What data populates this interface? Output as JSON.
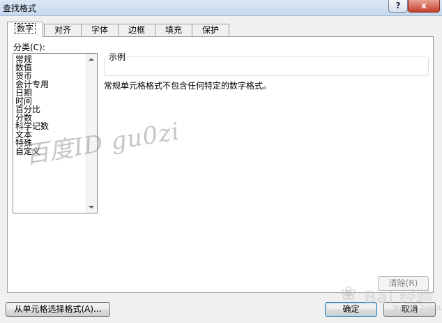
{
  "window": {
    "title": "查找格式",
    "help_label": "?",
    "close_label": "x"
  },
  "tabs": [
    {
      "label": "数字",
      "active": true
    },
    {
      "label": "对齐",
      "active": false
    },
    {
      "label": "字体",
      "active": false
    },
    {
      "label": "边框",
      "active": false
    },
    {
      "label": "填充",
      "active": false
    },
    {
      "label": "保护",
      "active": false
    }
  ],
  "category": {
    "label": "分类(C):",
    "items": [
      "常规",
      "数值",
      "货币",
      "会计专用",
      "日期",
      "时间",
      "百分比",
      "分数",
      "科学记数",
      "文本",
      "特殊",
      "自定义"
    ]
  },
  "sample": {
    "label": "示例",
    "value": ""
  },
  "description": "常规单元格格式不包含任何特定的数字格式。",
  "buttons": {
    "clear": "清除(R)",
    "choose_from_cell": "从单元格选择格式(A)...",
    "ok": "确定",
    "cancel": "取消"
  },
  "watermark": {
    "text": "百度ID  gu0zi",
    "brand": "Bai 经验",
    "brand_sub": "jingyan.baidu.com"
  }
}
